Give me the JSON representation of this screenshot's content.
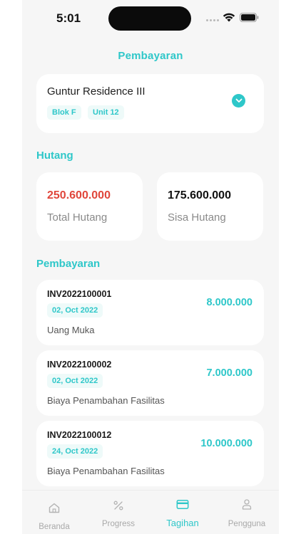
{
  "status_bar": {
    "time": "5:01"
  },
  "header": {
    "title": "Pembayaran"
  },
  "property": {
    "name": "Guntur Residence III",
    "blok": "Blok F",
    "unit": "Unit 12"
  },
  "debt": {
    "section_title": "Hutang",
    "total_value": "250.600.000",
    "total_label": "Total Hutang",
    "remaining_value": "175.600.000",
    "remaining_label": "Sisa Hutang"
  },
  "payments": {
    "section_title": "Pembayaran",
    "items": [
      {
        "invoice": "INV2022100001",
        "date": "02, Oct 2022",
        "description": "Uang Muka",
        "amount": "8.000.000"
      },
      {
        "invoice": "INV2022100002",
        "date": "02, Oct 2022",
        "description": "Biaya Penambahan Fasilitas",
        "amount": "7.000.000"
      },
      {
        "invoice": "INV2022100012",
        "date": "24, Oct 2022",
        "description": "Biaya Penambahan Fasilitas",
        "amount": "10.000.000"
      }
    ]
  },
  "nav": {
    "items": [
      {
        "label": "Beranda",
        "icon": "home-icon"
      },
      {
        "label": "Progress",
        "icon": "percent-icon"
      },
      {
        "label": "Tagihan",
        "icon": "card-icon"
      },
      {
        "label": "Pengguna",
        "icon": "user-icon"
      }
    ],
    "active_index": 2
  },
  "colors": {
    "accent": "#2ec7c9",
    "debt_total": "#e0463b",
    "background": "#f6f6f6",
    "card": "#ffffff"
  }
}
